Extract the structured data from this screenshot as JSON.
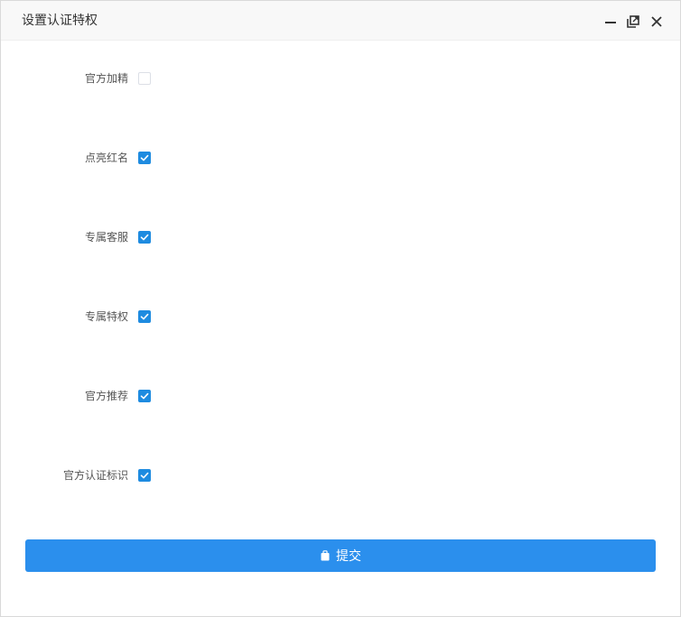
{
  "dialog": {
    "title": "设置认证特权"
  },
  "form": {
    "items": [
      {
        "label": "官方加精",
        "checked": false
      },
      {
        "label": "点亮红名",
        "checked": true
      },
      {
        "label": "专属客服",
        "checked": true
      },
      {
        "label": "专属特权",
        "checked": true
      },
      {
        "label": "官方推荐",
        "checked": true
      },
      {
        "label": "官方认证标识",
        "checked": true
      }
    ]
  },
  "submit": {
    "label": "提交"
  },
  "colors": {
    "accent": "#2b8fed",
    "checkbox_checked": "#1e8be0"
  }
}
